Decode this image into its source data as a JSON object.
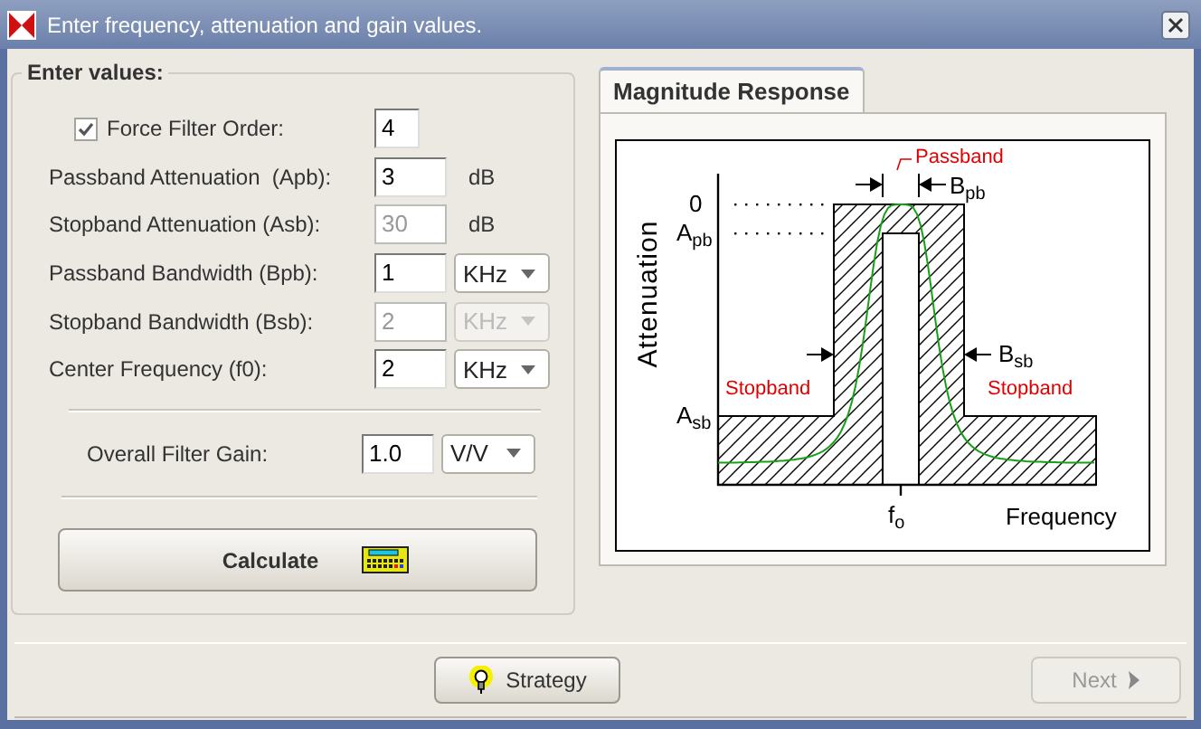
{
  "window": {
    "title": "Enter frequency, attenuation and gain values."
  },
  "form": {
    "legend": "Enter values:",
    "force_order": {
      "label": "Force Filter Order:",
      "checked": true,
      "value": "4"
    },
    "fields": [
      {
        "label": "Passband Attenuation  (Apb):",
        "value": "3",
        "disabled": false,
        "kind": "unit",
        "unit": "dB"
      },
      {
        "label": "Stopband Attenuation (Asb):",
        "value": "30",
        "disabled": true,
        "kind": "unit",
        "unit": "dB"
      },
      {
        "label": "Passband Bandwidth (Bpb):",
        "value": "1",
        "disabled": false,
        "kind": "dropdown",
        "unit": "KHz"
      },
      {
        "label": "Stopband Bandwidth (Bsb):",
        "value": "2",
        "disabled": true,
        "kind": "dropdown",
        "unit": "KHz"
      },
      {
        "label": "Center Frequency (f0):",
        "value": "2",
        "disabled": false,
        "kind": "dropdown",
        "unit": "KHz"
      }
    ],
    "gain": {
      "label": "Overall Filter Gain:",
      "value": "1.0",
      "unit": "V/V"
    },
    "calculate_button": "Calculate"
  },
  "tab": {
    "label": "Magnitude Response",
    "selected": true
  },
  "diagram": {
    "passband": "Passband",
    "b_pb": "B$_{pb}$",
    "zero": "0",
    "a_pb": "A$_{pb}$",
    "y_axis": "Attenuation",
    "b_sb": "B$_{sb}$",
    "stopband_left": "Stopband",
    "stopband_right": "Stopband",
    "a_sb": "A$_{sb}$",
    "f0": "f$_{o}$",
    "x_axis": "Frequency"
  },
  "footer": {
    "strategy_button": "Strategy",
    "next_button": {
      "label": "Next",
      "disabled": true
    }
  }
}
